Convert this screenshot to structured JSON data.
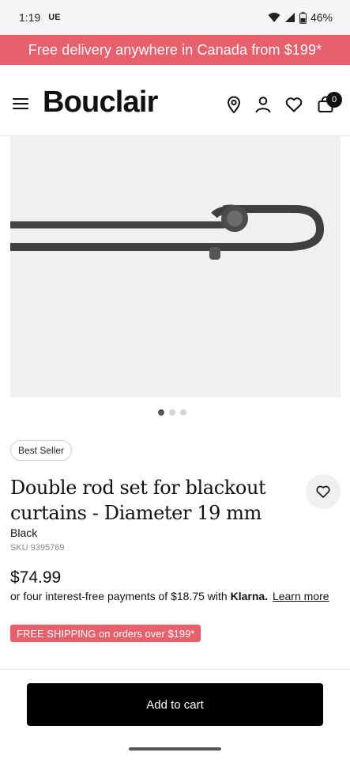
{
  "status_bar": {
    "time": "1:19",
    "carrier": "UE",
    "battery": "46%"
  },
  "promo": {
    "text": "Free delivery anywhere in Canada from $199*",
    "color": "#e8606b"
  },
  "header": {
    "logo": "Bouclair",
    "cart_count": "0",
    "icons": [
      "menu-icon",
      "location-pin-icon",
      "account-icon",
      "heart-icon",
      "shopping-bag-icon"
    ]
  },
  "carousel": {
    "total": 3,
    "active": 1
  },
  "product": {
    "badge": "Best Seller",
    "title": "Double rod set for blackout curtains - Diameter 19 mm",
    "color": "Black",
    "sku": "SKU 9395769",
    "price": "$74.99",
    "klarna_prefix": "or four interest-free payments of $18.75 with",
    "klarna_brand": "Klarna.",
    "klarna_link": "Learn more",
    "shipping": "FREE SHIPPING on orders over $199*"
  },
  "cta": {
    "add_to_cart": "Add to cart"
  }
}
